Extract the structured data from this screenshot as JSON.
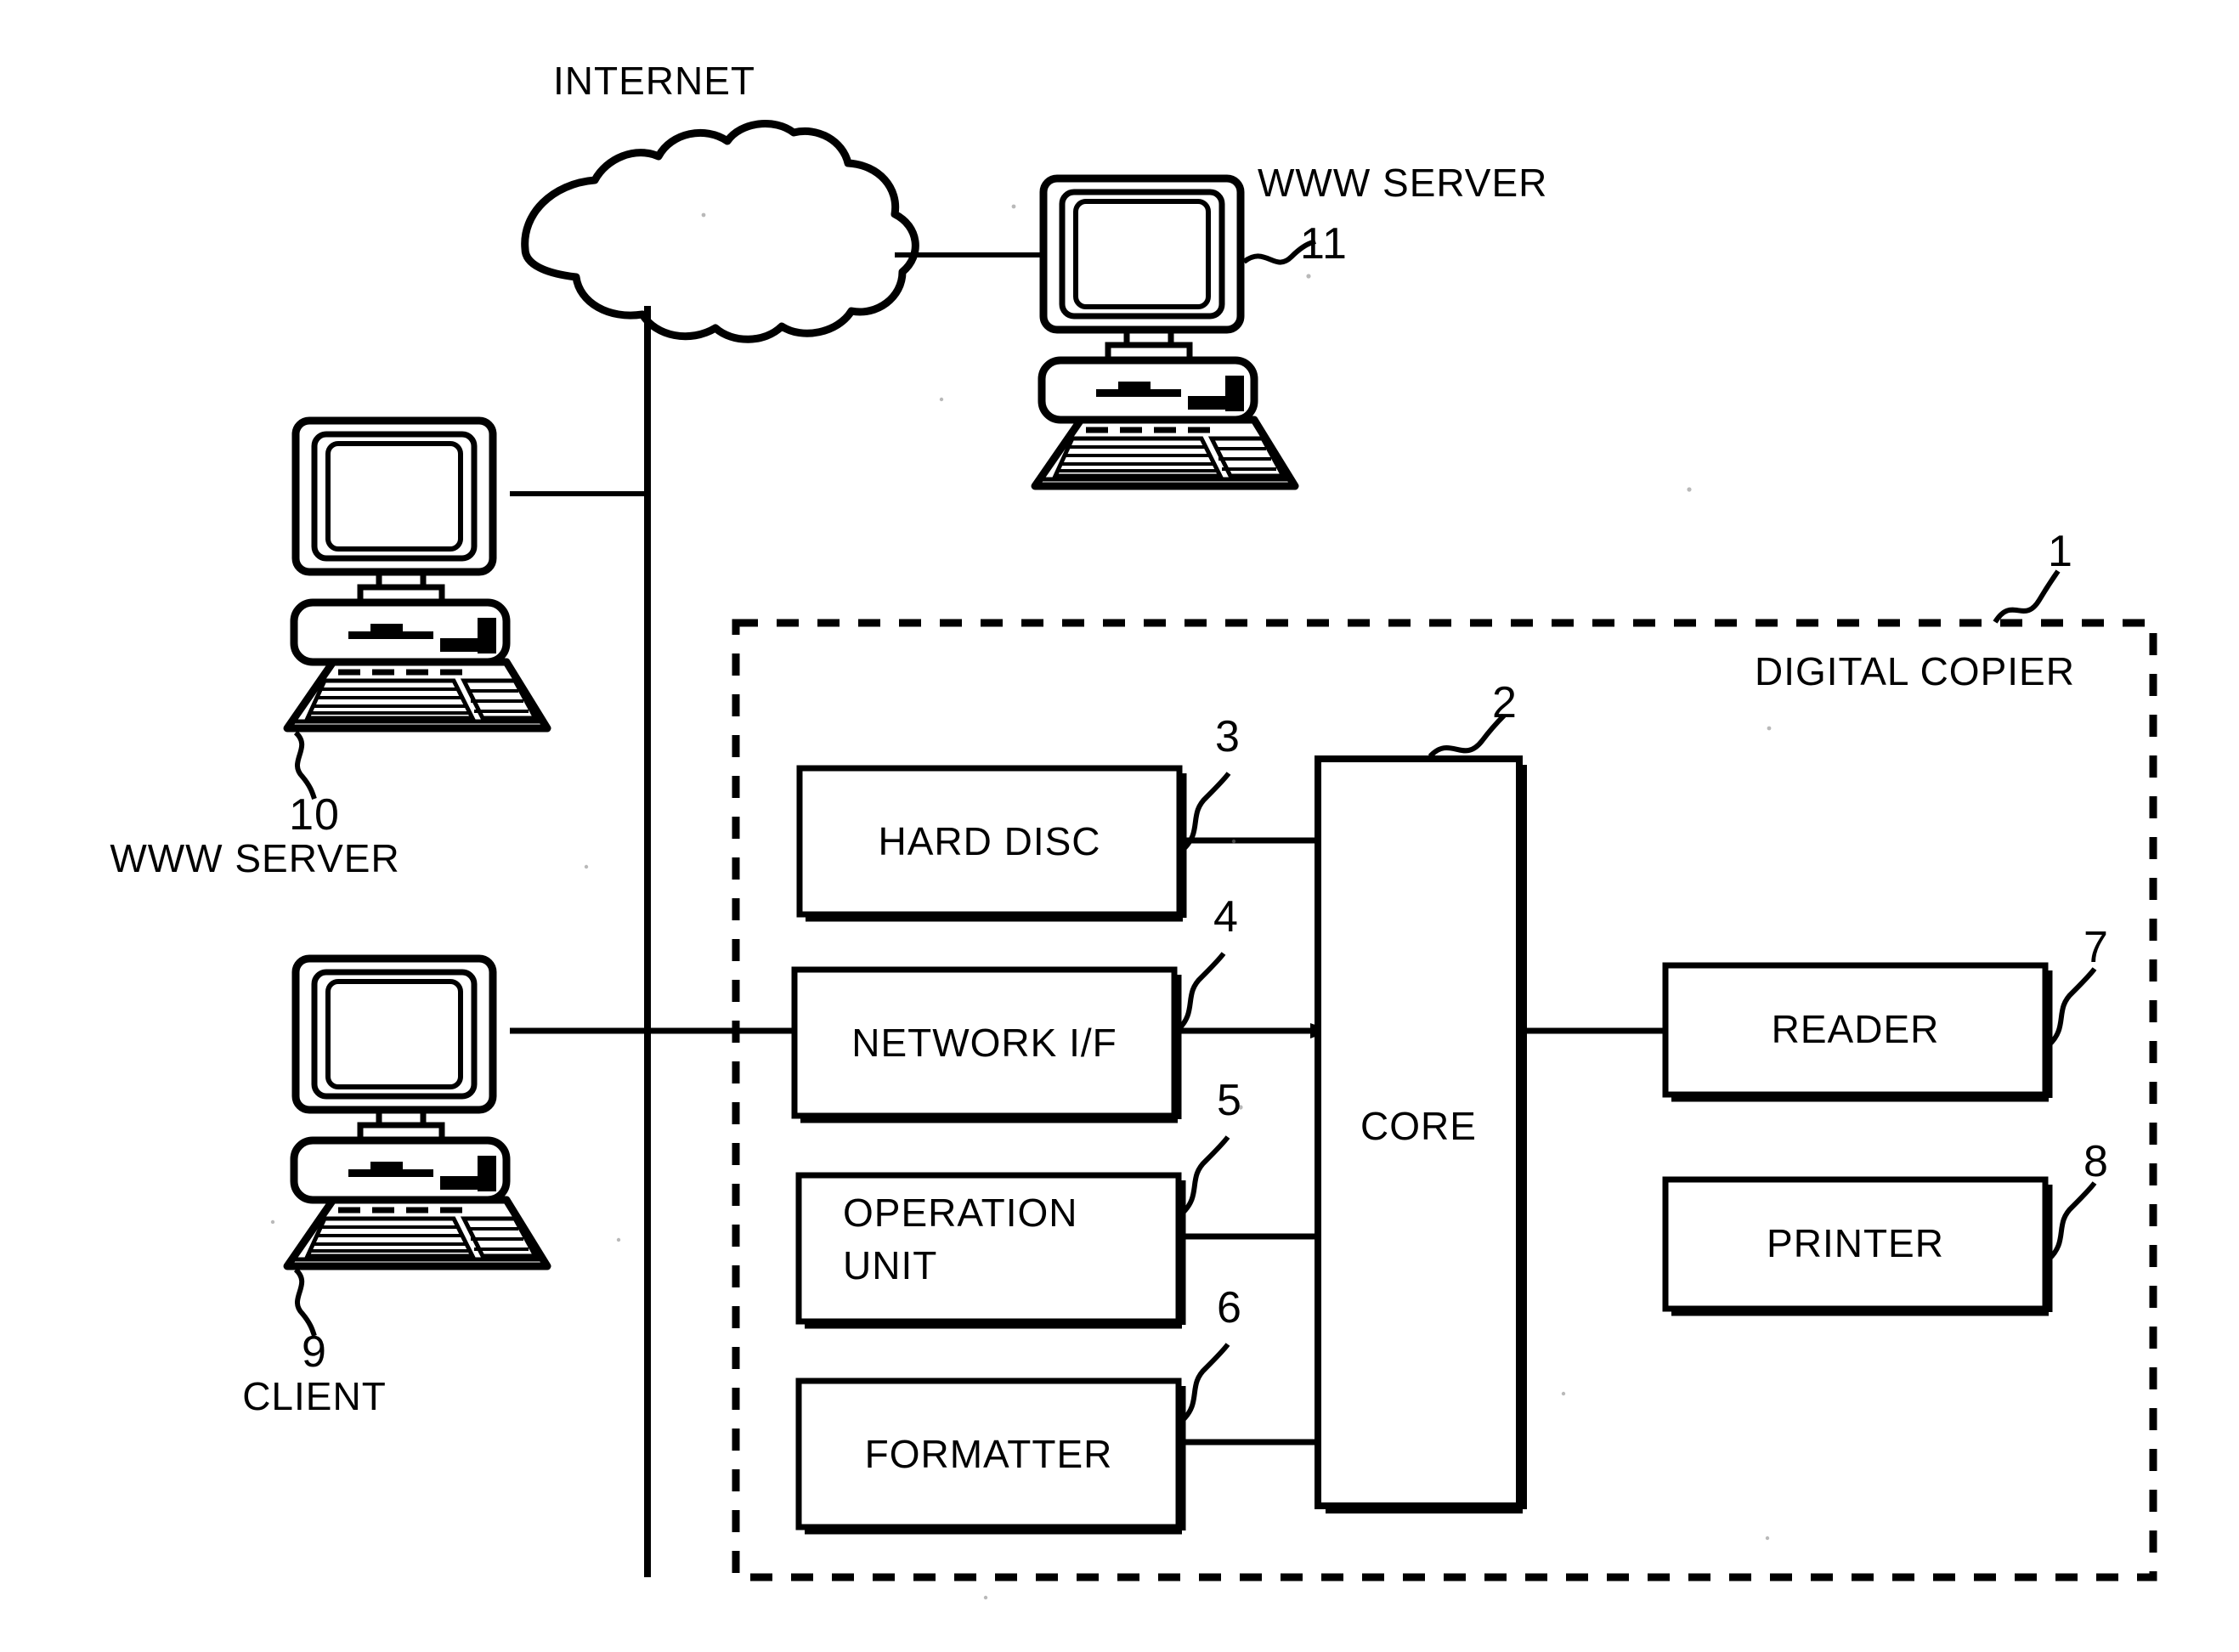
{
  "figure": {
    "title": "Digital copier network configuration diagram",
    "stroke_color": "#000000",
    "background_color": "#ffffff"
  },
  "network": {
    "internet_label": "INTERNET",
    "cloud_name": "internet-cloud"
  },
  "nodes": [
    {
      "id": "www-server-11",
      "label": "WWW SERVER",
      "ref_number": "11",
      "kind": "computer"
    },
    {
      "id": "www-server-10",
      "label": "WWW SERVER",
      "ref_number": "10",
      "kind": "computer"
    },
    {
      "id": "client-9",
      "label": "CLIENT",
      "ref_number": "9",
      "kind": "computer"
    }
  ],
  "copier": {
    "label": "DIGITAL COPIER",
    "ref_number": "1",
    "blocks": [
      {
        "id": "hard-disc",
        "label": "HARD DISC",
        "ref_number": "3"
      },
      {
        "id": "network-if",
        "label": "NETWORK I/F",
        "ref_number": "4"
      },
      {
        "id": "operation-unit",
        "label_line1": "OPERATION",
        "label_line2": "UNIT",
        "ref_number": "5"
      },
      {
        "id": "formatter",
        "label": "FORMATTER",
        "ref_number": "6"
      },
      {
        "id": "core",
        "label": "CORE",
        "ref_number": "2"
      },
      {
        "id": "reader",
        "label": "READER",
        "ref_number": "7"
      },
      {
        "id": "printer",
        "label": "PRINTER",
        "ref_number": "8"
      }
    ]
  },
  "labels": {
    "internet": "INTERNET",
    "www_server_top": "WWW SERVER",
    "num_11": "11",
    "www_server_left": "WWW SERVER",
    "num_10": "10",
    "client": "CLIENT",
    "num_9": "9",
    "digital_copier": "DIGITAL COPIER",
    "num_1": "1",
    "hard_disc": "HARD DISC",
    "num_3": "3",
    "network_if": "NETWORK I/F",
    "num_4": "4",
    "operation_line1": "OPERATION",
    "operation_line2": "UNIT",
    "num_5": "5",
    "formatter": "FORMATTER",
    "num_6": "6",
    "core": "CORE",
    "num_2": "2",
    "reader": "READER",
    "num_7": "7",
    "printer": "PRINTER",
    "num_8": "8"
  }
}
